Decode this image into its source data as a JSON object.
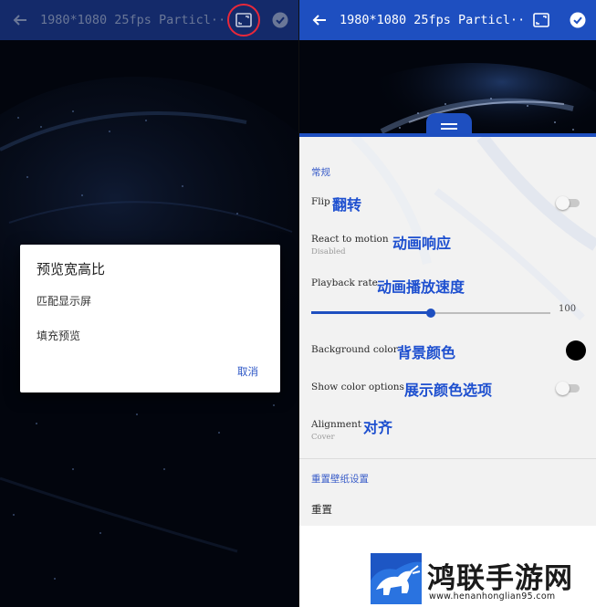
{
  "left_screen": {
    "toolbar": {
      "title": "1980*1080 25fps Particl···"
    },
    "dialog": {
      "title": "预览宽高比",
      "options": [
        "匹配显示屏",
        "填充预览"
      ],
      "cancel_label": "取消"
    }
  },
  "right_screen": {
    "toolbar": {
      "title": "1980*1080 25fps Particl···"
    },
    "settings": {
      "section_general": "常规",
      "flip": {
        "label": "Flip",
        "annotation": "翻转",
        "enabled": false
      },
      "react_to_motion": {
        "label": "React to motion",
        "subtitle": "Disabled",
        "annotation": "动画响应"
      },
      "playback_rate": {
        "label": "Playback rate",
        "annotation": "动画播放速度",
        "value": 100,
        "slider_fraction": 0.5
      },
      "background_color": {
        "label": "Background color",
        "annotation": "背景颜色",
        "color": "#000000"
      },
      "show_color_options": {
        "label": "Show color options",
        "annotation": "展示颜色选项",
        "enabled": false
      },
      "alignment": {
        "label": "Alignment",
        "subtitle": "Cover",
        "annotation": "对齐"
      },
      "section_reset": "重置壁纸设置",
      "reset_label": "重置"
    }
  },
  "watermark": {
    "brand": "鸿联手游网",
    "url": "www.henanhonglian95.com"
  },
  "colors": {
    "accent_blue": "#1e4fc0",
    "annotation_blue": "#1d4fcf",
    "highlight_circle": "#e8283a"
  }
}
